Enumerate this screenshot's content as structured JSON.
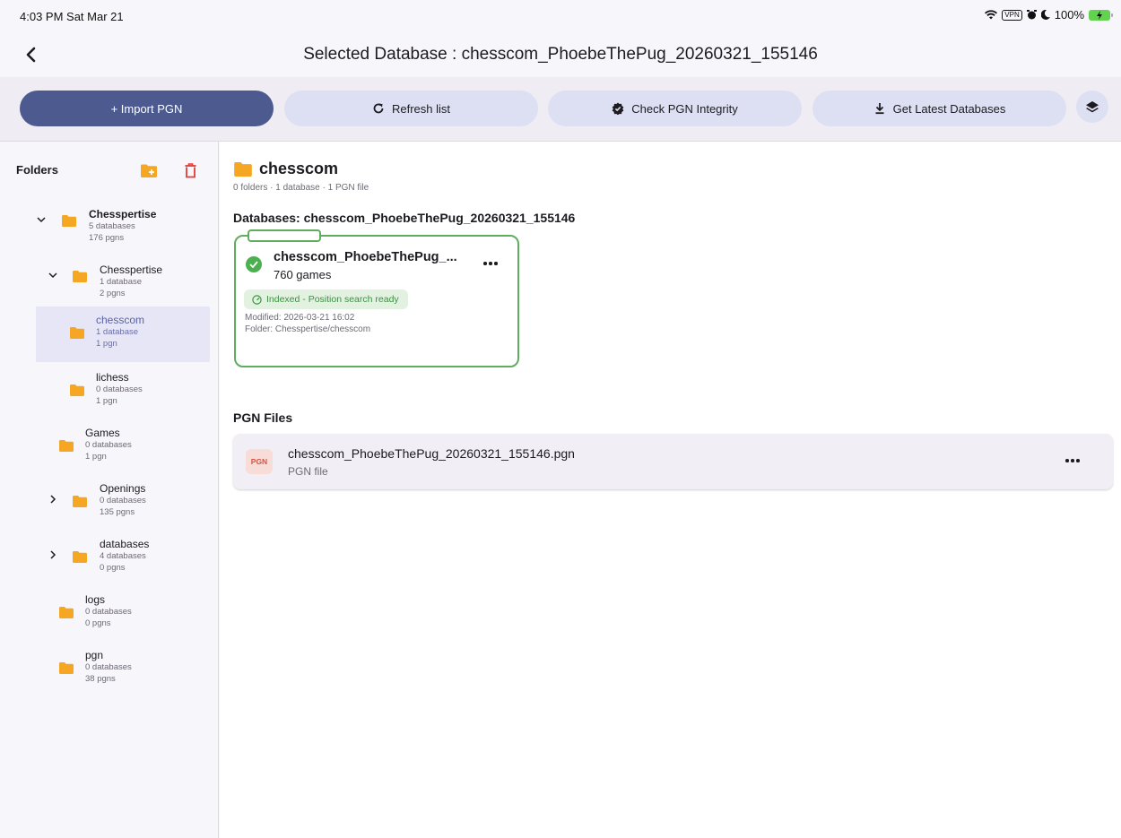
{
  "status_bar": {
    "time": "4:03 PM  Sat Mar 21",
    "vpn": "VPN",
    "battery": "100%"
  },
  "app_bar": {
    "title": "Selected Database : chesscom_PhoebeThePug_20260321_155146",
    "back_icon": "chevron-left-icon"
  },
  "toolbar": {
    "import_label": "+  Import PGN",
    "refresh_label": "Refresh list",
    "integrity_label": "Check PGN Integrity",
    "latest_label": "Get Latest Databases",
    "layers_icon": "layers-icon"
  },
  "sidebar": {
    "title": "Folders",
    "new_folder_icon": "new-folder-icon",
    "delete_icon": "trash-icon",
    "items": [
      {
        "name": "Chesspertise",
        "databases": "5 databases",
        "pgns": "176 pgns",
        "expanded": true
      },
      {
        "name": "Chesspertise",
        "databases": "1 database",
        "pgns": "2 pgns",
        "expanded": true
      },
      {
        "name": "chesscom",
        "databases": "1 database",
        "pgns": "1 pgn",
        "selected": true
      },
      {
        "name": "lichess",
        "databases": "0 databases",
        "pgns": "1 pgn"
      },
      {
        "name": "Games",
        "databases": "0 databases",
        "pgns": "1 pgn"
      },
      {
        "name": "Openings",
        "databases": "0 databases",
        "pgns": "135 pgns",
        "expanded": false
      },
      {
        "name": "databases",
        "databases": "4 databases",
        "pgns": "0 pgns",
        "expanded": false
      },
      {
        "name": "logs",
        "databases": "0 databases",
        "pgns": "0 pgns"
      },
      {
        "name": "pgn",
        "databases": "0 databases",
        "pgns": "38 pgns"
      }
    ]
  },
  "main": {
    "folder_name": "chesscom",
    "folder_summary": "0 folders · 1 database · 1 PGN file",
    "databases_heading": "Databases: chesscom_PhoebeThePug_20260321_155146",
    "database_card": {
      "name": "chesscom_PhoebeThePug_...",
      "games": "760 games",
      "badge": "Indexed - Position search ready",
      "modified": "Modified: 2026-03-21 16:02",
      "folder": "Folder: Chesspertise/chesscom"
    },
    "pgn_heading": "PGN Files",
    "pgn_file": {
      "badge": "PGN",
      "name": "chesscom_PhoebeThePug_20260321_155146.pgn",
      "type": "PGN file"
    }
  },
  "colors": {
    "primary": "#4d5a8f",
    "tonal": "#dde0f3",
    "folder": "#f5a623",
    "success": "#4caf50",
    "danger": "#e53935",
    "pgn_badge": "#d65444"
  }
}
